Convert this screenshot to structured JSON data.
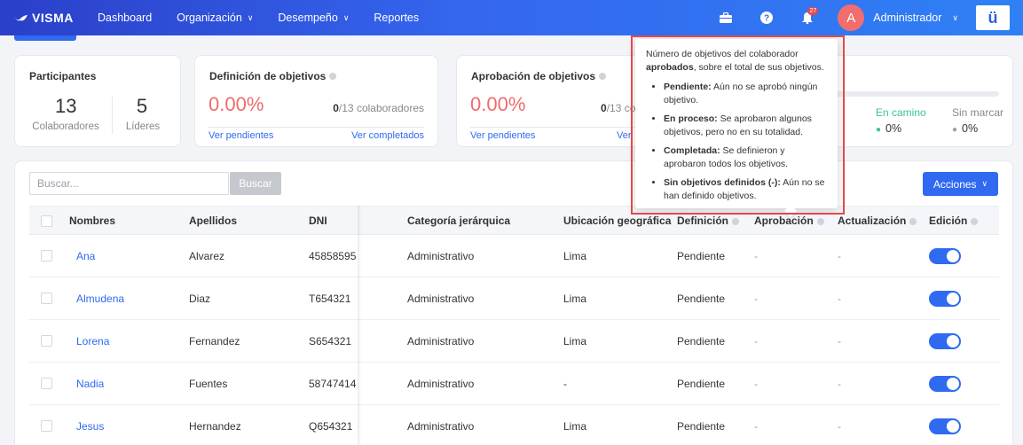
{
  "nav": {
    "logo": "VISMA",
    "items": [
      "Dashboard",
      "Organización",
      "Desempeño",
      "Reportes"
    ],
    "notification_count": "27",
    "avatar_initial": "A",
    "user": "Administrador",
    "brand_glyph": "ü"
  },
  "cards": {
    "participants": {
      "title": "Participantes",
      "collaborators_count": "13",
      "collaborators_label": "Colaboradores",
      "leaders_count": "5",
      "leaders_label": "Líderes"
    },
    "definition": {
      "title": "Definición de objetivos",
      "percent": "0.00%",
      "count_bold": "0",
      "count_rest": "/13 colaboradores",
      "link_pending": "Ver pendientes",
      "link_completed": "Ver completados"
    },
    "approval": {
      "title": "Aprobación de objetivos",
      "percent": "0.00%",
      "count_bold": "0",
      "count_rest": "/13 cola",
      "link_pending": "Ver pendientes",
      "link_completed": "Ver"
    },
    "progress": {
      "on_track_label": "En camino",
      "on_track_value": "0%",
      "unmarked_label": "Sin marcar",
      "unmarked_value": "0%",
      "on_track_color": "#3cc39a",
      "unmarked_color": "#9aa0a8"
    }
  },
  "tooltip": {
    "intro_1": "Número de objetivos del colaborador",
    "intro_bold": "aprobados",
    "intro_2": ", sobre el total de sus objetivos.",
    "items": [
      {
        "term": "Pendiente:",
        "desc": " Aún no se aprobó ningún objetivo."
      },
      {
        "term": "En proceso:",
        "desc": " Se aprobaron algunos objetivos, pero no en su totalidad."
      },
      {
        "term": "Completada:",
        "desc": " Se definieron y aprobaron todos los objetivos."
      },
      {
        "term": "Sin objetivos definidos (-):",
        "desc": " Aún no se han definido objetivos."
      }
    ]
  },
  "table": {
    "search_placeholder": "Buscar...",
    "search_button": "Buscar",
    "actions_button": "Acciones",
    "headers": [
      "Nombres",
      "Apellidos",
      "DNI",
      "Categoría jerárquica",
      "Ubicación geográfica",
      "Definición",
      "Aprobación",
      "Actualización",
      "Edición"
    ],
    "rows": [
      {
        "name": "Ana",
        "surname": "Alvarez",
        "dni": "45858595",
        "category": "Administrativo",
        "location": "Lima",
        "definition": "Pendiente",
        "approval": "-",
        "update": "-"
      },
      {
        "name": "Almudena",
        "surname": "Diaz",
        "dni": "T654321",
        "category": "Administrativo",
        "location": "Lima",
        "definition": "Pendiente",
        "approval": "-",
        "update": "-"
      },
      {
        "name": "Lorena",
        "surname": "Fernandez",
        "dni": "S654321",
        "category": "Administrativo",
        "location": "Lima",
        "definition": "Pendiente",
        "approval": "-",
        "update": "-"
      },
      {
        "name": "Nadia",
        "surname": "Fuentes",
        "dni": "58747414",
        "category": "Administrativo",
        "location": "-",
        "definition": "Pendiente",
        "approval": "-",
        "update": "-"
      },
      {
        "name": "Jesus",
        "surname": "Hernandez",
        "dni": "Q654321",
        "category": "Administrativo",
        "location": "Lima",
        "definition": "Pendiente",
        "approval": "-",
        "update": "-"
      }
    ]
  },
  "colors": {
    "primary": "#2f6af0",
    "percent_red": "#ef6c6c",
    "highlight_red": "#e5484d"
  }
}
